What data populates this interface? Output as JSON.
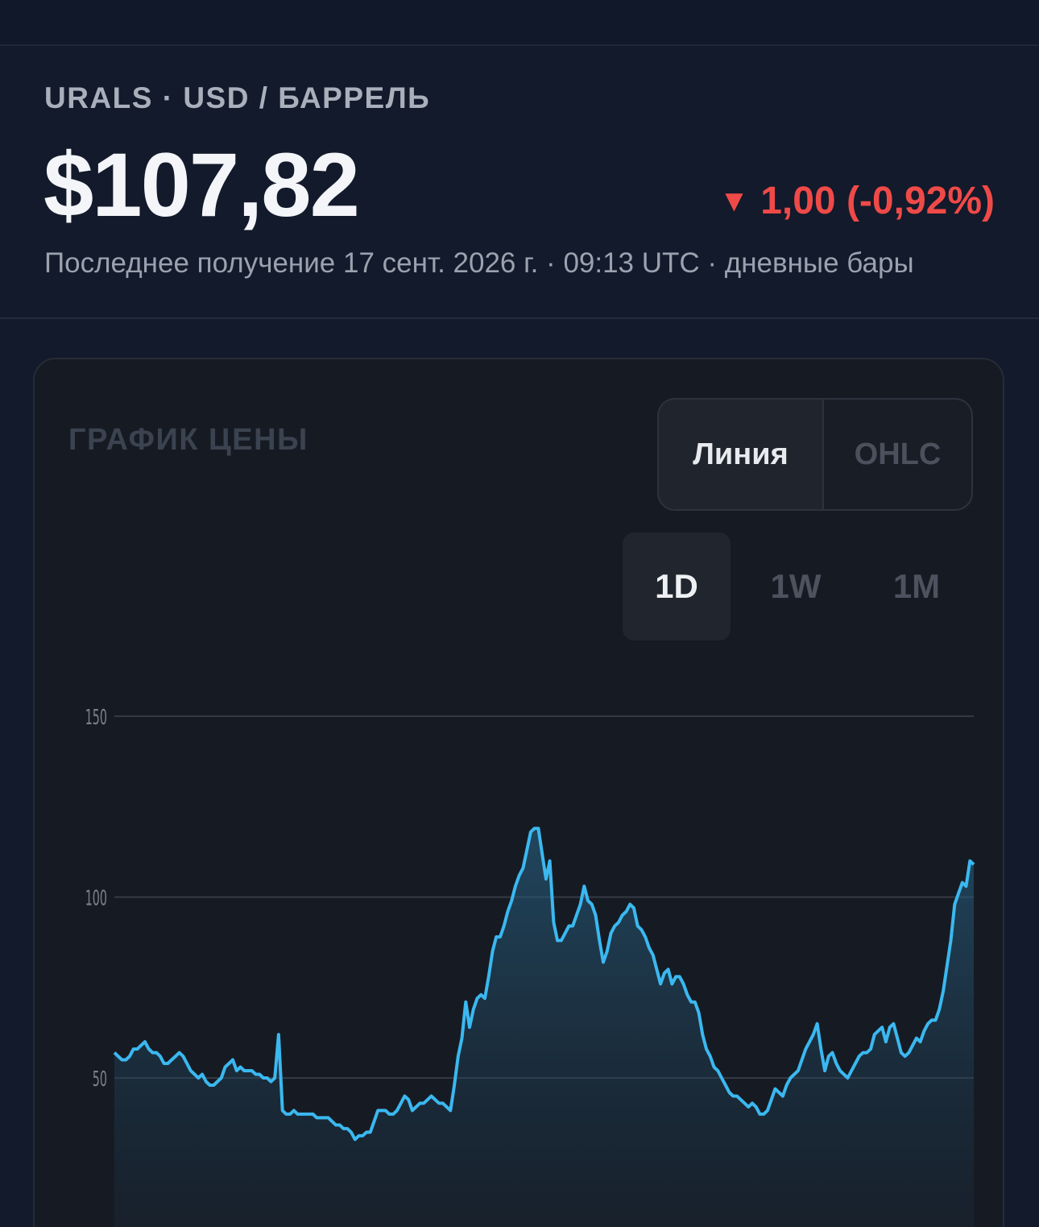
{
  "header": {
    "instrument": "URALS · USD / БАРРЕЛЬ",
    "price": "$107,82",
    "change_arrow": "▼",
    "change": "1,00 (-0,92%)",
    "subtitle": "Последнее получение 17 сент. 2026 г. · 09:13 UTC · дневные бары"
  },
  "chart_card": {
    "title": "ГРАФИК ЦЕНЫ",
    "chart_type_options": [
      {
        "label": "Линия",
        "active": true
      },
      {
        "label": "OHLC",
        "active": false
      }
    ],
    "timeframes": [
      {
        "label": "1D",
        "active": true
      },
      {
        "label": "1W",
        "active": false
      },
      {
        "label": "1M",
        "active": false
      }
    ]
  },
  "colors": {
    "line": "#3bb8f0",
    "down": "#ef4a48",
    "background": "#121a2b",
    "card": "#161b23"
  },
  "chart_data": {
    "type": "area",
    "title": "",
    "xlabel": "",
    "ylabel": "",
    "ylim": [
      20,
      150
    ],
    "yticks": [
      "150",
      "100",
      "50"
    ],
    "grid": true,
    "series": [
      {
        "values": [
          57,
          56,
          55,
          55,
          56,
          58,
          58,
          59,
          60,
          58,
          57,
          57,
          56,
          54,
          54,
          55,
          56,
          57,
          56,
          54,
          52,
          51,
          50,
          51,
          49,
          48,
          48,
          49,
          50,
          53,
          54,
          55,
          52,
          53,
          52,
          52,
          52,
          51,
          51,
          50,
          50,
          49,
          50,
          62,
          41,
          40,
          40,
          41,
          40,
          40,
          40,
          40,
          40,
          39,
          39,
          39,
          39,
          38,
          37,
          37,
          36,
          36,
          35,
          33,
          34,
          34,
          35,
          35,
          38,
          41,
          41,
          41,
          40,
          40,
          41,
          43,
          45,
          44,
          41,
          42,
          43,
          43,
          44,
          45,
          44,
          43,
          43,
          42,
          41,
          48,
          56,
          61,
          71,
          64,
          69,
          72,
          73,
          72,
          78,
          85,
          89,
          89,
          92,
          96,
          99,
          103,
          106,
          108,
          113,
          118,
          119,
          119,
          112,
          105,
          110,
          93,
          88,
          88,
          90,
          92,
          92,
          95,
          98,
          103,
          99,
          98,
          95,
          88,
          82,
          85,
          90,
          92,
          93,
          95,
          96,
          98,
          97,
          92,
          91,
          89,
          86,
          84,
          80,
          76,
          79,
          80,
          76,
          78,
          78,
          76,
          73,
          71,
          71,
          68,
          62,
          58,
          56,
          53,
          52,
          50,
          48,
          46,
          45,
          45,
          44,
          43,
          42,
          43,
          42,
          40,
          40,
          41,
          44,
          47,
          46,
          45,
          48,
          50,
          51,
          52,
          55,
          58,
          60,
          62,
          65,
          58,
          52,
          56,
          57,
          54,
          52,
          51,
          50,
          52,
          54,
          56,
          57,
          57,
          58,
          62,
          63,
          64,
          60,
          64,
          65,
          61,
          57,
          56,
          57,
          59,
          61,
          60,
          63,
          65,
          66,
          66,
          69,
          74,
          81,
          88,
          98,
          101,
          104,
          103,
          110,
          109
        ]
      }
    ]
  }
}
